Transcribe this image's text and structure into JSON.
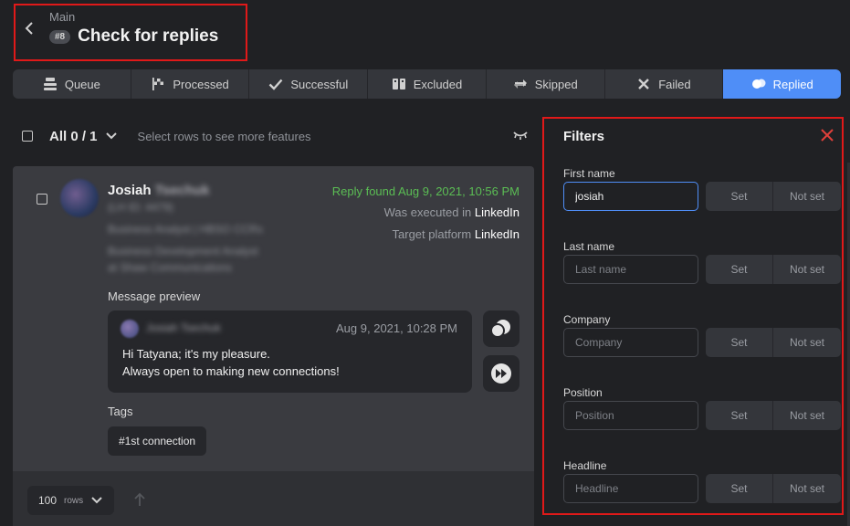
{
  "header": {
    "breadcrumb": "Main",
    "badge": "#8",
    "title": "Check for replies"
  },
  "tabs": [
    {
      "label": "Queue",
      "icon": "queue-icon"
    },
    {
      "label": "Processed",
      "icon": "flag-icon"
    },
    {
      "label": "Successful",
      "icon": "check-icon"
    },
    {
      "label": "Excluded",
      "icon": "excluded-icon"
    },
    {
      "label": "Skipped",
      "icon": "skip-icon"
    },
    {
      "label": "Failed",
      "icon": "x-icon"
    },
    {
      "label": "Replied",
      "icon": "chat-bubbles-icon",
      "active": true
    }
  ],
  "toolbar": {
    "all_count": "All 0 / 1",
    "hint": "Select rows to see more features"
  },
  "card": {
    "first_name": "Josiah",
    "last_name_blurred": "Tsechuk",
    "id_blurred": "(LH ID: 4479)",
    "headline_blurred": "Business Analyst | HBSO CCRs",
    "position_blurred": "Business Development Analyst",
    "company_blurred": "at Shaw Communications",
    "reply_found": "Reply found Aug 9, 2021, 10:56 PM",
    "executed_prefix": "Was executed in",
    "executed_platform": "LinkedIn",
    "target_prefix": "Target platform",
    "target_platform": "LinkedIn",
    "message_preview_label": "Message preview",
    "message": {
      "sender_blurred": "Josiah Tsechuk",
      "time": "Aug 9, 2021, 10:28 PM",
      "line1": "Hi Tatyana; it's my pleasure.",
      "line2": "Always open to making new connections!"
    },
    "tags_label": "Tags",
    "tags": [
      "#1st connection"
    ]
  },
  "footer": {
    "rows_value": "100",
    "rows_unit": "rows"
  },
  "filters": {
    "title": "Filters",
    "set_label": "Set",
    "not_set_label": "Not set",
    "fields": [
      {
        "label": "First name",
        "value": "josiah",
        "placeholder": "First name"
      },
      {
        "label": "Last name",
        "value": "",
        "placeholder": "Last name"
      },
      {
        "label": "Company",
        "value": "",
        "placeholder": "Company"
      },
      {
        "label": "Position",
        "value": "",
        "placeholder": "Position"
      },
      {
        "label": "Headline",
        "value": "",
        "placeholder": "Headline"
      }
    ]
  },
  "colors": {
    "accent": "#4f8ef7",
    "success": "#5bbd54",
    "highlight_border": "#e01919"
  }
}
